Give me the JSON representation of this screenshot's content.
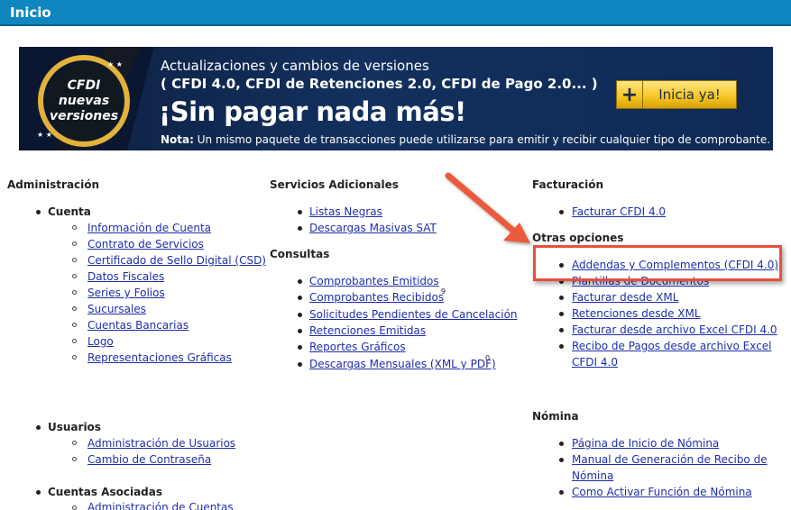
{
  "header": {
    "title": "Inicio"
  },
  "banner": {
    "badge": [
      "CFDI",
      "nuevas",
      "versiones"
    ],
    "line1": "Actualizaciones y cambios de versiones",
    "line2": "( CFDI 4.0, CFDI de Retenciones 2.0, CFDI de Pago 2.0... )",
    "headline": "¡Sin pagar nada más!",
    "note_label": "Nota:",
    "note_text": " Un mismo paquete de transacciones puede utilizarse para emitir y recibir cualquier tipo de comprobante.",
    "cta_plus": "+",
    "cta_label": "Inicia ya!"
  },
  "administracion": {
    "title": "Administración",
    "cuenta": {
      "label": "Cuenta",
      "items": [
        "Información de Cuenta",
        "Contrato de Servicios",
        "Certificado de Sello Digital (CSD)",
        "Datos Fiscales",
        "Series y Folios",
        "Sucursales",
        "Cuentas Bancarias",
        "Logo",
        "Representaciones Gráficas"
      ]
    },
    "usuarios": {
      "label": "Usuarios",
      "items": [
        "Administración de Usuarios",
        "Cambio de Contraseña"
      ]
    },
    "asociadas": {
      "label": "Cuentas Asociadas",
      "items": [
        "Administración de Cuentas"
      ]
    }
  },
  "servicios": {
    "title": "Servicios Adicionales",
    "items": [
      "Listas Negras",
      "Descargas Masivas SAT"
    ]
  },
  "consultas": {
    "title": "Consultas",
    "items": [
      "Comprobantes Emitidos",
      "Comprobantes Recibidos",
      "Solicitudes Pendientes de Cancelación",
      "Retenciones Emitidas",
      "Reportes Gráficos",
      "Descargas Mensuales (XML y PDF)"
    ],
    "badge_recibidos": "9",
    "badge_descargas": "0"
  },
  "facturacion": {
    "title": "Facturación",
    "items": [
      "Facturar CFDI 4.0"
    ]
  },
  "otras": {
    "title": "Otras opciones",
    "items": [
      "Addendas y Complementos (CFDI 4.0)",
      "Plantillas de Documentos",
      "Facturar desde XML",
      "Retenciones desde XML",
      "Facturar desde archivo Excel CFDI 4.0",
      "Recibo de Pagos desde archivo Excel",
      "CFDI 4.0"
    ]
  },
  "nomina": {
    "title": "Nómina",
    "items": [
      "Página de Inicio de Nómina",
      "Manual de Generación de Recibo de",
      "Nómina",
      "Como Activar Función de Nómina"
    ]
  },
  "colors": {
    "header": "#0f86bf",
    "link": "#1d2fa8",
    "highlight": "#e8503a"
  }
}
